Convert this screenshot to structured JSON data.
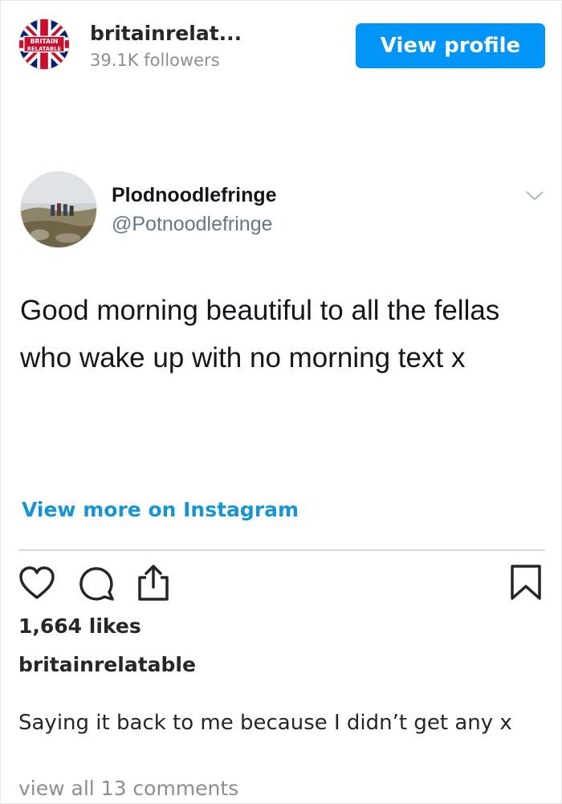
{
  "header": {
    "avatar_text": "BRITAIN RELATABLE",
    "username": "britainrelat...",
    "followers": "39.1K followers",
    "view_profile_label": "View profile"
  },
  "tweet": {
    "display_name": "Plodnoodlefringe",
    "handle": "@Potnoodlefringe",
    "text": "Good morning beautiful to all the fellas who wake up with no morning text x"
  },
  "view_more_label": "View more on Instagram",
  "actions": {
    "like_icon": "heart-icon",
    "comment_icon": "comment-icon",
    "share_icon": "share-icon",
    "save_icon": "bookmark-icon"
  },
  "post": {
    "likes": "1,664 likes",
    "caption_username": "britainrelatable",
    "caption": "Saying it back to me because I didn’t get any x",
    "comments_link": "view all 13 comments"
  },
  "colors": {
    "accent": "#0095f6",
    "link": "#1595d6",
    "muted": "#8e8e8e"
  }
}
